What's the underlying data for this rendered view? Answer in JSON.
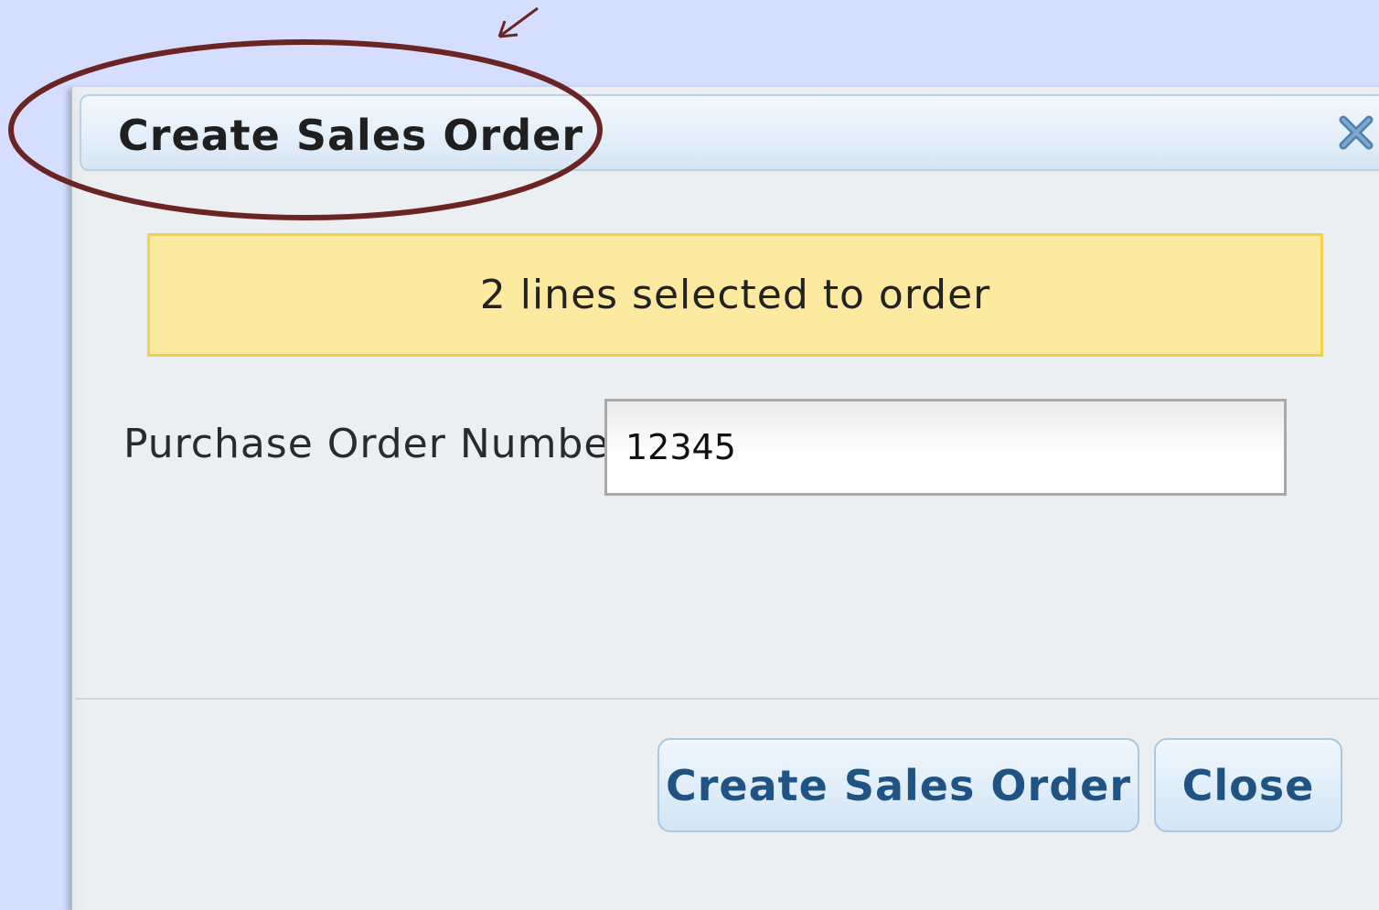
{
  "dialog": {
    "title": "Create Sales Order",
    "close_icon": "close-icon",
    "info_message": "2 lines selected to order",
    "po_label": "Purchase Order Number:",
    "po_value": "12345",
    "buttons": {
      "create_label": "Create Sales Order",
      "close_label": "Close"
    }
  },
  "colors": {
    "page_background": "#d5defe",
    "dialog_background": "#eceff1",
    "banner_background": "#fbeaa0",
    "banner_border": "#f2d24a",
    "button_text": "#1e5384",
    "close_icon": "#4d7fb0",
    "annotation": "#6b2424"
  }
}
